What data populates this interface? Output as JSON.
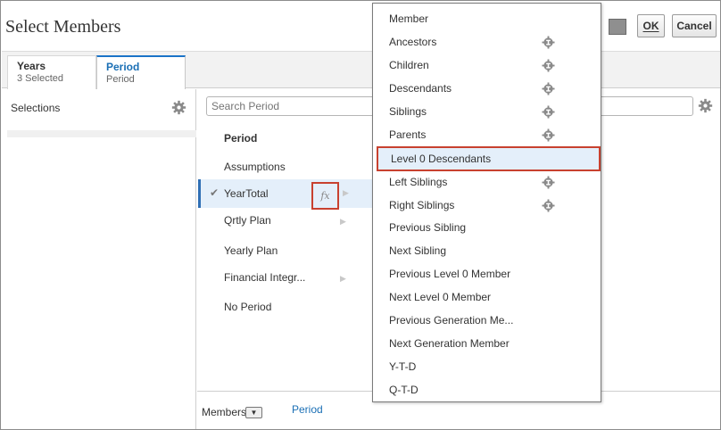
{
  "dialog": {
    "title": "Select Members",
    "ok_label": "OK",
    "cancel_label": "Cancel"
  },
  "tabs": [
    {
      "title": "Years",
      "subtitle": "3 Selected"
    },
    {
      "title": "Period",
      "subtitle": "Period"
    }
  ],
  "selections": {
    "label": "Selections"
  },
  "tree": {
    "search_placeholder": "Search Period",
    "header": "Period",
    "rows": [
      {
        "label": "Assumptions"
      },
      {
        "label": "YearTotal"
      },
      {
        "label": "Qrtly Plan"
      },
      {
        "label": "Yearly Plan"
      },
      {
        "label": "Financial Integr..."
      },
      {
        "label": "No Period"
      }
    ],
    "fx_glyph": "fx",
    "check_glyph": "✔",
    "arrow_glyph": "▶"
  },
  "footer": {
    "members_label": "Members",
    "dropdown_glyph": "▼",
    "period_link": "Period"
  },
  "menu": {
    "items": [
      {
        "label": "Member"
      },
      {
        "label": "Ancestors"
      },
      {
        "label": "Children"
      },
      {
        "label": "Descendants"
      },
      {
        "label": "Siblings"
      },
      {
        "label": "Parents"
      },
      {
        "label": "Level 0 Descendants"
      },
      {
        "label": "Left Siblings"
      },
      {
        "label": "Right Siblings"
      },
      {
        "label": "Previous Sibling"
      },
      {
        "label": "Next Sibling"
      },
      {
        "label": "Previous Level 0 Member"
      },
      {
        "label": "Next Level 0 Member"
      },
      {
        "label": "Previous Generation Me..."
      },
      {
        "label": "Next Generation Member"
      },
      {
        "label": "Y-T-D"
      },
      {
        "label": "Q-T-D"
      }
    ]
  },
  "colors": {
    "accent_blue": "#1a6fb5",
    "highlight_border": "#c8412f",
    "selected_bg": "#e4effa"
  }
}
